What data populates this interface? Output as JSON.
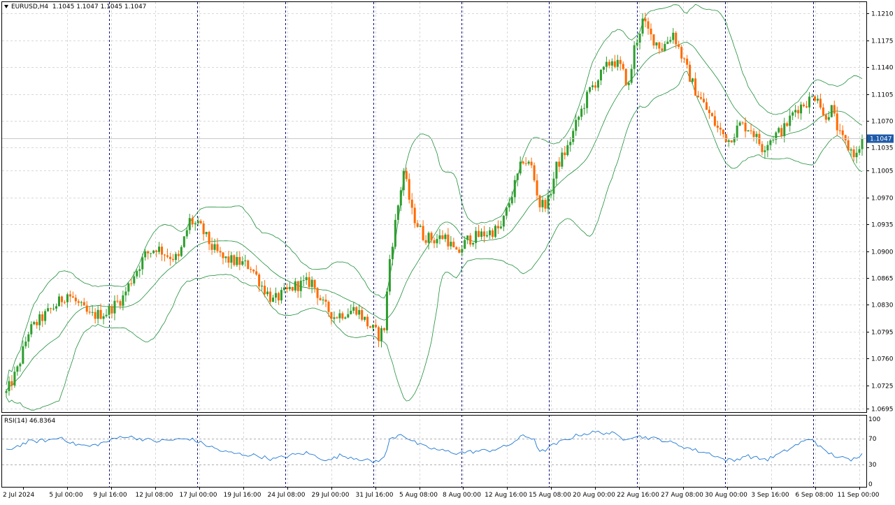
{
  "header": {
    "symbol_timeframe": "EURUSD,H4",
    "ohlc": "1.1045 1.1047 1.1045 1.1047"
  },
  "rsi_panel": {
    "label": "RSI(14) 46.8364",
    "levels": [
      "100",
      "70",
      "30",
      "0"
    ]
  },
  "price_axis": {
    "ticks": [
      "1.1210",
      "1.1175",
      "1.1140",
      "1.1105",
      "1.1070",
      "1.1035",
      "1.1005",
      "1.0970",
      "1.0935",
      "1.0900",
      "1.0865",
      "1.0830",
      "1.0795",
      "1.0760",
      "1.0725",
      "1.0695"
    ],
    "current_price_label": "1.1047"
  },
  "time_axis": {
    "ticks": [
      "2 Jul 2024",
      "5 Jul 00:00",
      "9 Jul 16:00",
      "12 Jul 08:00",
      "17 Jul 00:00",
      "19 Jul 16:00",
      "24 Jul 08:00",
      "29 Jul 00:00",
      "31 Jul 16:00",
      "5 Aug 08:00",
      "8 Aug 00:00",
      "12 Aug 16:00",
      "15 Aug 08:00",
      "20 Aug 00:00",
      "22 Aug 16:00",
      "27 Aug 08:00",
      "30 Aug 00:00",
      "3 Sep 16:00",
      "6 Sep 08:00",
      "11 Sep 00:00"
    ]
  },
  "colors": {
    "bull": "#2e9e2e",
    "bear": "#ff6a00",
    "bands": "#1f8f3a",
    "rsi": "#1e78d2",
    "grid": "#d8d8d8",
    "separator": "#000080",
    "axis": "#000000",
    "price_tag_bg": "#1e5aa8"
  },
  "chart_data": [
    {
      "type": "candlestick",
      "title": "EURUSD,H4",
      "indicator": "Bollinger Bands",
      "ylim": [
        1.069,
        1.1225
      ],
      "close_trajectory": [
        [
          0,
          1.0715
        ],
        [
          4,
          1.0745
        ],
        [
          8,
          1.0795
        ],
        [
          12,
          1.081
        ],
        [
          18,
          1.083
        ],
        [
          22,
          1.0845
        ],
        [
          26,
          1.083
        ],
        [
          30,
          1.0815
        ],
        [
          36,
          1.082
        ],
        [
          42,
          1.084
        ],
        [
          46,
          1.087
        ],
        [
          50,
          1.0895
        ],
        [
          54,
          1.0905
        ],
        [
          58,
          1.0895
        ],
        [
          62,
          1.089
        ],
        [
          66,
          1.094
        ],
        [
          70,
          1.093
        ],
        [
          74,
          1.0905
        ],
        [
          78,
          1.089
        ],
        [
          84,
          1.0885
        ],
        [
          88,
          1.088
        ],
        [
          92,
          1.0855
        ],
        [
          96,
          1.0835
        ],
        [
          100,
          1.0845
        ],
        [
          104,
          1.0855
        ],
        [
          110,
          1.086
        ],
        [
          114,
          1.083
        ],
        [
          118,
          1.0815
        ],
        [
          122,
          1.082
        ],
        [
          126,
          1.0825
        ],
        [
          130,
          1.0805
        ],
        [
          134,
          1.079
        ],
        [
          136,
          1.08
        ],
        [
          138,
          1.089
        ],
        [
          141,
          1.096
        ],
        [
          143,
          1.1005
        ],
        [
          146,
          1.095
        ],
        [
          150,
          1.092
        ],
        [
          154,
          1.0915
        ],
        [
          158,
          1.092
        ],
        [
          162,
          1.0895
        ],
        [
          166,
          1.0915
        ],
        [
          170,
          1.092
        ],
        [
          174,
          1.0925
        ],
        [
          178,
          1.093
        ],
        [
          182,
          1.0975
        ],
        [
          186,
          1.102
        ],
        [
          189,
          1.101
        ],
        [
          192,
          1.096
        ],
        [
          195,
          1.0965
        ],
        [
          198,
          1.101
        ],
        [
          202,
          1.1035
        ],
        [
          206,
          1.1075
        ],
        [
          210,
          1.111
        ],
        [
          214,
          1.113
        ],
        [
          218,
          1.115
        ],
        [
          221,
          1.114
        ],
        [
          224,
          1.1115
        ],
        [
          226,
          1.1165
        ],
        [
          229,
          1.12
        ],
        [
          232,
          1.118
        ],
        [
          236,
          1.1165
        ],
        [
          240,
          1.1185
        ],
        [
          244,
          1.1145
        ],
        [
          248,
          1.111
        ],
        [
          252,
          1.1085
        ],
        [
          256,
          1.106
        ],
        [
          260,
          1.1045
        ],
        [
          264,
          1.1065
        ],
        [
          268,
          1.106
        ],
        [
          272,
          1.1035
        ],
        [
          276,
          1.105
        ],
        [
          280,
          1.106
        ],
        [
          284,
          1.1085
        ],
        [
          288,
          1.1095
        ],
        [
          292,
          1.1105
        ],
        [
          294,
          1.1075
        ],
        [
          297,
          1.1085
        ],
        [
          300,
          1.105
        ],
        [
          303,
          1.1035
        ],
        [
          306,
          1.1025
        ],
        [
          308,
          1.1047
        ]
      ]
    },
    {
      "type": "line",
      "title": "RSI(14) 46.8364",
      "ylim": [
        0,
        100
      ],
      "reference_levels": [
        70,
        30
      ],
      "values_trajectory": [
        [
          0,
          52
        ],
        [
          8,
          65
        ],
        [
          16,
          68
        ],
        [
          20,
          72
        ],
        [
          24,
          62
        ],
        [
          30,
          58
        ],
        [
          36,
          65
        ],
        [
          42,
          74
        ],
        [
          48,
          70
        ],
        [
          54,
          66
        ],
        [
          60,
          68
        ],
        [
          66,
          70
        ],
        [
          72,
          60
        ],
        [
          78,
          50
        ],
        [
          84,
          46
        ],
        [
          90,
          44
        ],
        [
          96,
          38
        ],
        [
          102,
          44
        ],
        [
          108,
          48
        ],
        [
          112,
          42
        ],
        [
          116,
          36
        ],
        [
          120,
          44
        ],
        [
          126,
          40
        ],
        [
          132,
          34
        ],
        [
          136,
          40
        ],
        [
          138,
          68
        ],
        [
          142,
          78
        ],
        [
          146,
          66
        ],
        [
          150,
          58
        ],
        [
          156,
          52
        ],
        [
          162,
          48
        ],
        [
          168,
          50
        ],
        [
          174,
          52
        ],
        [
          180,
          58
        ],
        [
          186,
          74
        ],
        [
          190,
          70
        ],
        [
          192,
          48
        ],
        [
          196,
          58
        ],
        [
          200,
          66
        ],
        [
          206,
          76
        ],
        [
          212,
          80
        ],
        [
          218,
          78
        ],
        [
          222,
          70
        ],
        [
          226,
          74
        ],
        [
          230,
          72
        ],
        [
          236,
          68
        ],
        [
          242,
          60
        ],
        [
          248,
          52
        ],
        [
          254,
          46
        ],
        [
          258,
          38
        ],
        [
          262,
          36
        ],
        [
          266,
          44
        ],
        [
          270,
          40
        ],
        [
          274,
          38
        ],
        [
          280,
          50
        ],
        [
          286,
          64
        ],
        [
          290,
          70
        ],
        [
          294,
          52
        ],
        [
          298,
          44
        ],
        [
          304,
          36
        ],
        [
          308,
          47
        ]
      ]
    }
  ]
}
